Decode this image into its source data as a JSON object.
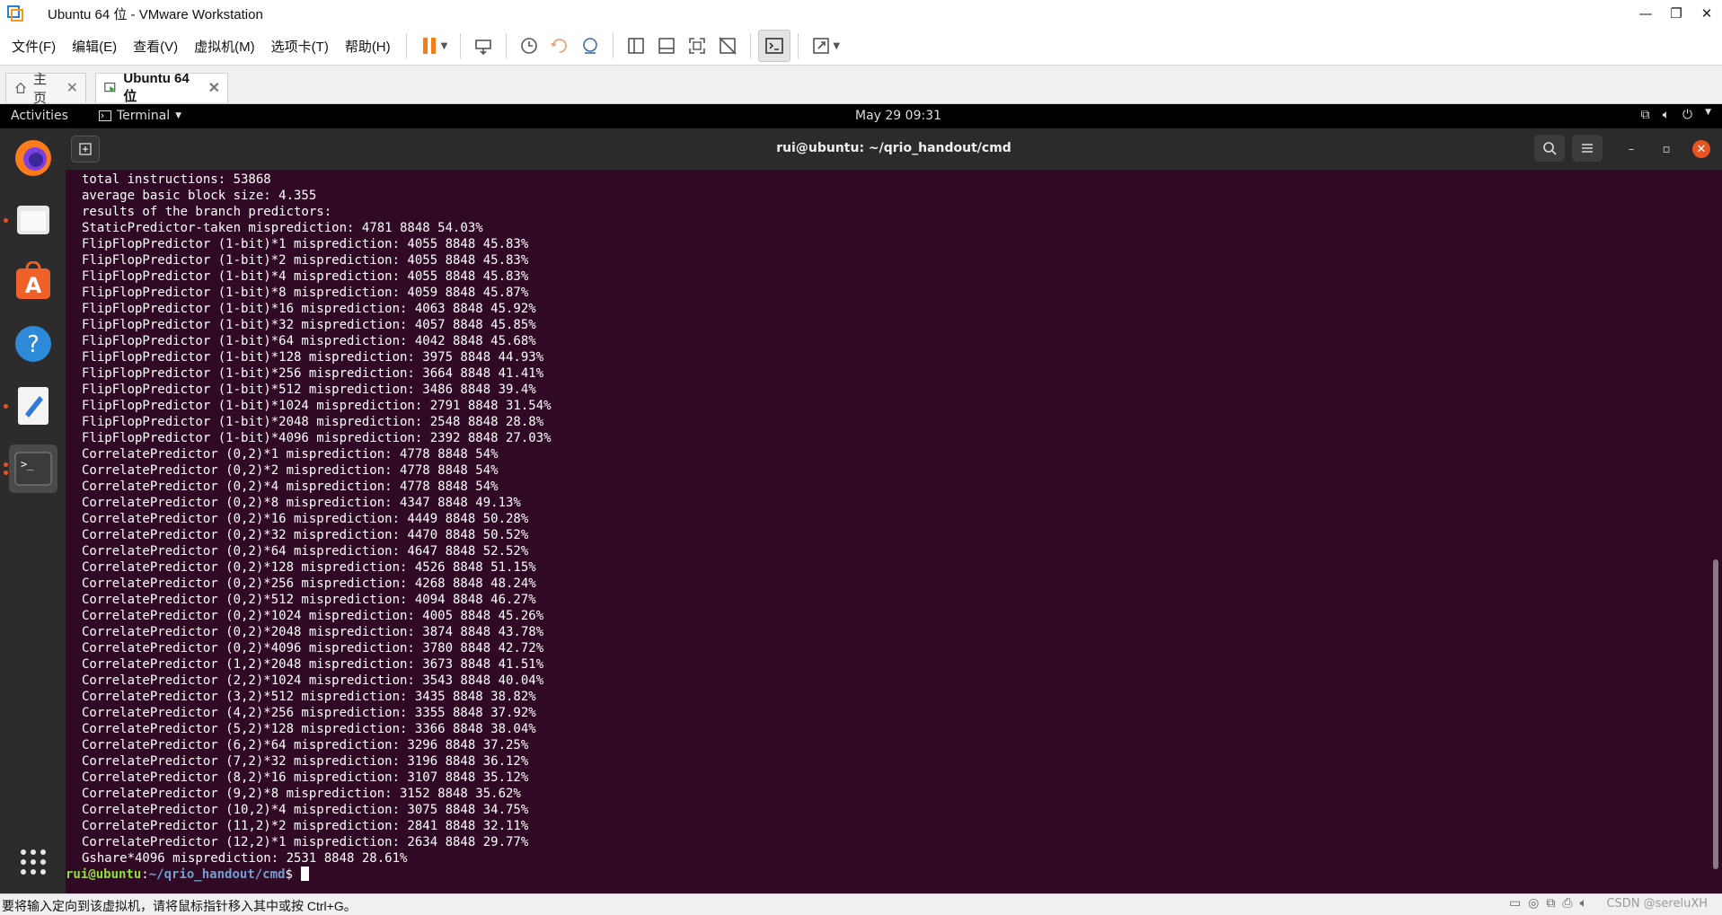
{
  "window": {
    "title": "Ubuntu 64 位 - VMware Workstation",
    "controls": [
      "—",
      "❐",
      "✕"
    ]
  },
  "menubar": {
    "items": [
      "文件(F)",
      "编辑(E)",
      "查看(V)",
      "虚拟机(M)",
      "选项卡(T)",
      "帮助(H)"
    ]
  },
  "tabs": [
    {
      "label": "主页"
    },
    {
      "label": "Ubuntu 64 位"
    }
  ],
  "gnome_panel": {
    "activities": "Activities",
    "app_menu": "Terminal",
    "clock": "May 29  09:31"
  },
  "dock": {
    "icons": [
      "firefox-icon",
      "files-icon",
      "software-icon",
      "help-icon",
      "text-editor-icon",
      "terminal-icon",
      "app-grid-icon"
    ]
  },
  "terminal": {
    "title": "rui@ubuntu: ~/qrio_handout/cmd",
    "lines": [
      "total instructions: 53868",
      "average basic block size: 4.355",
      "results of the branch predictors:",
      "StaticPredictor-taken misprediction: 4781 8848 54.03%",
      "FlipFlopPredictor (1-bit)*1 misprediction: 4055 8848 45.83%",
      "FlipFlopPredictor (1-bit)*2 misprediction: 4055 8848 45.83%",
      "FlipFlopPredictor (1-bit)*4 misprediction: 4055 8848 45.83%",
      "FlipFlopPredictor (1-bit)*8 misprediction: 4059 8848 45.87%",
      "FlipFlopPredictor (1-bit)*16 misprediction: 4063 8848 45.92%",
      "FlipFlopPredictor (1-bit)*32 misprediction: 4057 8848 45.85%",
      "FlipFlopPredictor (1-bit)*64 misprediction: 4042 8848 45.68%",
      "FlipFlopPredictor (1-bit)*128 misprediction: 3975 8848 44.93%",
      "FlipFlopPredictor (1-bit)*256 misprediction: 3664 8848 41.41%",
      "FlipFlopPredictor (1-bit)*512 misprediction: 3486 8848 39.4%",
      "FlipFlopPredictor (1-bit)*1024 misprediction: 2791 8848 31.54%",
      "FlipFlopPredictor (1-bit)*2048 misprediction: 2548 8848 28.8%",
      "FlipFlopPredictor (1-bit)*4096 misprediction: 2392 8848 27.03%",
      "CorrelatePredictor (0,2)*1 misprediction: 4778 8848 54%",
      "CorrelatePredictor (0,2)*2 misprediction: 4778 8848 54%",
      "CorrelatePredictor (0,2)*4 misprediction: 4778 8848 54%",
      "CorrelatePredictor (0,2)*8 misprediction: 4347 8848 49.13%",
      "CorrelatePredictor (0,2)*16 misprediction: 4449 8848 50.28%",
      "CorrelatePredictor (0,2)*32 misprediction: 4470 8848 50.52%",
      "CorrelatePredictor (0,2)*64 misprediction: 4647 8848 52.52%",
      "CorrelatePredictor (0,2)*128 misprediction: 4526 8848 51.15%",
      "CorrelatePredictor (0,2)*256 misprediction: 4268 8848 48.24%",
      "CorrelatePredictor (0,2)*512 misprediction: 4094 8848 46.27%",
      "CorrelatePredictor (0,2)*1024 misprediction: 4005 8848 45.26%",
      "CorrelatePredictor (0,2)*2048 misprediction: 3874 8848 43.78%",
      "CorrelatePredictor (0,2)*4096 misprediction: 3780 8848 42.72%",
      "CorrelatePredictor (1,2)*2048 misprediction: 3673 8848 41.51%",
      "CorrelatePredictor (2,2)*1024 misprediction: 3543 8848 40.04%",
      "CorrelatePredictor (3,2)*512 misprediction: 3435 8848 38.82%",
      "CorrelatePredictor (4,2)*256 misprediction: 3355 8848 37.92%",
      "CorrelatePredictor (5,2)*128 misprediction: 3366 8848 38.04%",
      "CorrelatePredictor (6,2)*64 misprediction: 3296 8848 37.25%",
      "CorrelatePredictor (7,2)*32 misprediction: 3196 8848 36.12%",
      "CorrelatePredictor (8,2)*16 misprediction: 3107 8848 35.12%",
      "CorrelatePredictor (9,2)*8 misprediction: 3152 8848 35.62%",
      "CorrelatePredictor (10,2)*4 misprediction: 3075 8848 34.75%",
      "CorrelatePredictor (11,2)*2 misprediction: 2841 8848 32.11%",
      "CorrelatePredictor (12,2)*1 misprediction: 2634 8848 29.77%",
      "Gshare*4096 misprediction: 2531 8848 28.61%"
    ],
    "prompt": {
      "user_host": "rui@ubuntu",
      "sep": ":",
      "path": "~/qrio_handout/cmd",
      "symbol": "$ "
    }
  },
  "statusbar": {
    "text": "要将输入定向到该虚拟机，请将鼠标指针移入其中或按 Ctrl+G。",
    "watermark": "CSDN @sereluXH"
  }
}
